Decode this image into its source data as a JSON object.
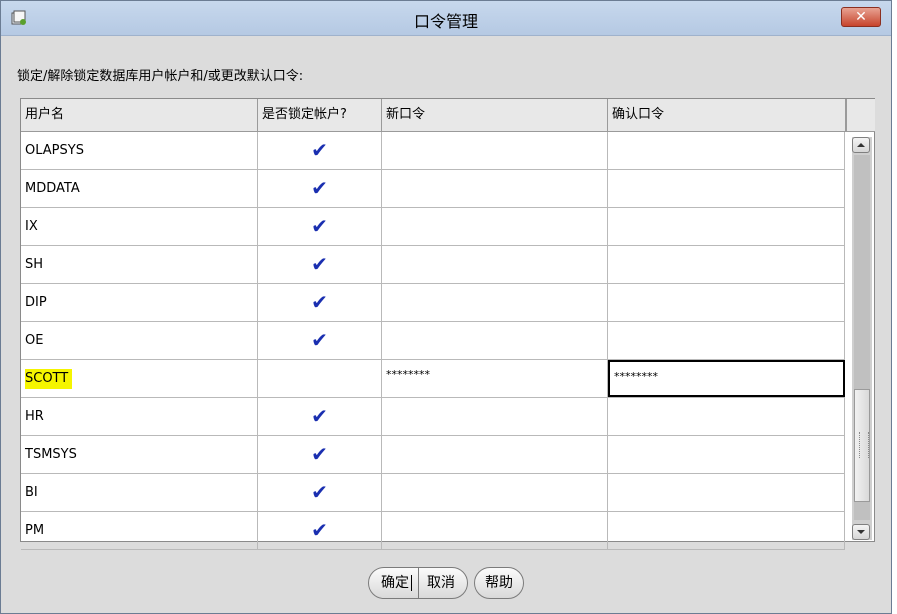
{
  "window": {
    "title": "口令管理",
    "close_label": "✕"
  },
  "instruction": "锁定/解除锁定数据库用户帐户和/或更改默认口令:",
  "table": {
    "columns": [
      "用户名",
      "是否锁定帐户?",
      "新口令",
      "确认口令"
    ],
    "rows": [
      {
        "user": "OLAPSYS",
        "locked": "✔",
        "new_pw": "",
        "confirm_pw": ""
      },
      {
        "user": "MDDATA",
        "locked": "✔",
        "new_pw": "",
        "confirm_pw": ""
      },
      {
        "user": "IX",
        "locked": "✔",
        "new_pw": "",
        "confirm_pw": ""
      },
      {
        "user": "SH",
        "locked": "✔",
        "new_pw": "",
        "confirm_pw": ""
      },
      {
        "user": "DIP",
        "locked": "✔",
        "new_pw": "",
        "confirm_pw": ""
      },
      {
        "user": "OE",
        "locked": "✔",
        "new_pw": "",
        "confirm_pw": ""
      },
      {
        "user": "SCOTT",
        "locked": "",
        "new_pw": "********",
        "confirm_pw": "********"
      },
      {
        "user": "HR",
        "locked": "✔",
        "new_pw": "",
        "confirm_pw": ""
      },
      {
        "user": "TSMSYS",
        "locked": "✔",
        "new_pw": "",
        "confirm_pw": ""
      },
      {
        "user": "BI",
        "locked": "✔",
        "new_pw": "",
        "confirm_pw": ""
      },
      {
        "user": "PM",
        "locked": "✔",
        "new_pw": "",
        "confirm_pw": ""
      }
    ]
  },
  "buttons": {
    "ok": "确定",
    "cancel": "取消",
    "help": "帮助"
  },
  "colors": {
    "highlight": "#f5f500",
    "check": "#1a2fb0",
    "close": "#c7442c"
  }
}
